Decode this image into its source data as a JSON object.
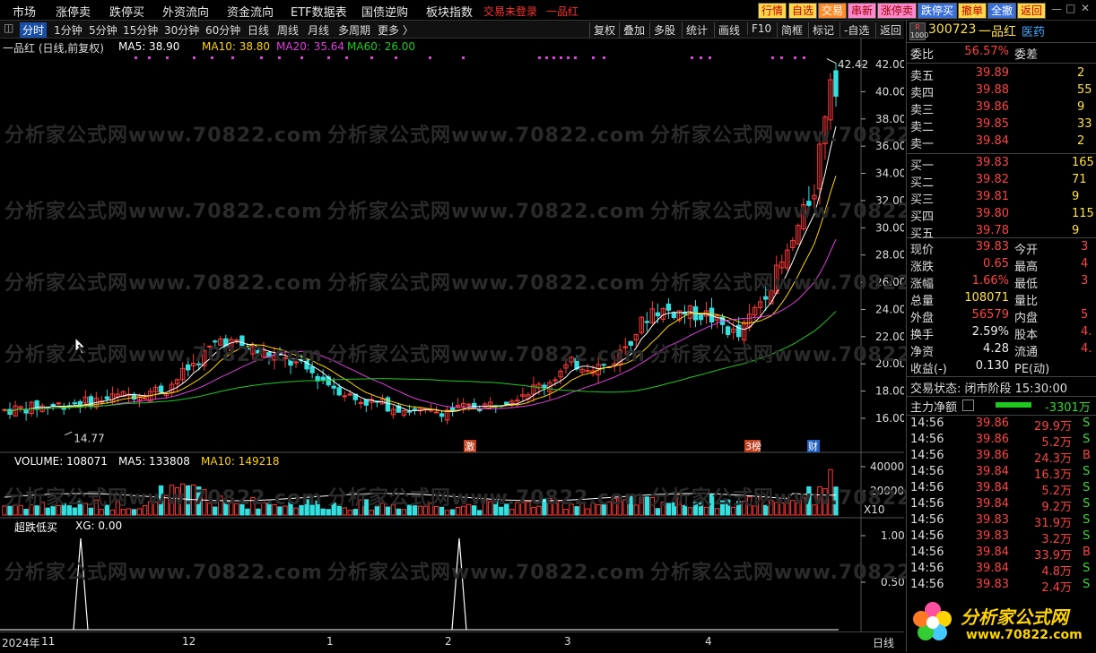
{
  "menu": [
    "市场",
    "涨停卖",
    "跌停买",
    "外资流向",
    "资金流向",
    "ETF数据表",
    "国债逆购",
    "板块指数"
  ],
  "menu_warning": "交易未登录",
  "menu_stock": "一品红",
  "top_buttons": [
    "行情",
    "自选",
    "交易",
    "串新",
    "涨停卖",
    "跌停买",
    "撤单",
    "全撤",
    "返回"
  ],
  "periods": [
    "分时",
    "1分钟",
    "5分钟",
    "15分钟",
    "30分钟",
    "60分钟",
    "日线",
    "周线",
    "月线",
    "多周期",
    "更多 〉"
  ],
  "selected_period": "分时",
  "right_tools": [
    "复权",
    "叠加",
    "多股",
    "统计",
    "画线",
    "F10",
    "简框",
    "标记",
    "-自选",
    "返回"
  ],
  "legend": {
    "title": "一品红 (日线,前复权)",
    "ma5": "MA5: 38.90",
    "ma10": "MA10: 38.80",
    "ma20": "MA20: 35.64",
    "ma60": "MA60: 26.00"
  },
  "price_axis": [
    "42.00",
    "40.00",
    "38.00",
    "36.00",
    "34.00",
    "32.00",
    "30.00",
    "28.00",
    "26.00",
    "24.00",
    "22.00",
    "20.00",
    "18.00",
    "16.00"
  ],
  "price_high_label": "42.42",
  "price_low_label": "14.77",
  "event_tags": [
    "激",
    "3榜",
    "财"
  ],
  "volume_legend": {
    "label": "VOLUME: 108071",
    "ma5": "MA5: 133808",
    "ma10": "MA10: 149218"
  },
  "volume_axis": [
    "40000",
    "20000"
  ],
  "volume_unit": "X10",
  "indicator_legend": {
    "name": "超跌低买",
    "xg": "XG: 0.00"
  },
  "indicator_axis": [
    "1.00",
    "0.50"
  ],
  "date_axis": [
    "2024年",
    "11",
    "12",
    "1",
    "2",
    "3",
    "4"
  ],
  "bottom_right": "日线",
  "watermark": "分析家公式网www.70822.com",
  "quote": {
    "code": "300723",
    "name": "一品红",
    "sector": "医药",
    "weibi_label": "委比",
    "weibi": "56.57%",
    "weicha_label": "委差",
    "asks": [
      {
        "label": "卖五",
        "price": "39.89",
        "vol": "2"
      },
      {
        "label": "卖四",
        "price": "39.88",
        "vol": "55"
      },
      {
        "label": "卖三",
        "price": "39.86",
        "vol": "9"
      },
      {
        "label": "卖二",
        "price": "39.85",
        "vol": "33"
      },
      {
        "label": "卖一",
        "price": "39.84",
        "vol": "2"
      }
    ],
    "bids": [
      {
        "label": "买一",
        "price": "39.83",
        "vol": "165"
      },
      {
        "label": "买二",
        "price": "39.82",
        "vol": "71"
      },
      {
        "label": "买三",
        "price": "39.81",
        "vol": "9"
      },
      {
        "label": "买四",
        "price": "39.80",
        "vol": "115"
      },
      {
        "label": "买五",
        "price": "39.78",
        "vol": "9"
      }
    ],
    "stats": [
      {
        "l1": "现价",
        "v1": "39.83",
        "c1": "red",
        "l2": "今开",
        "v2": "3"
      },
      {
        "l1": "涨跌",
        "v1": "0.65",
        "c1": "red",
        "l2": "最高",
        "v2": "4"
      },
      {
        "l1": "涨幅",
        "v1": "1.66%",
        "c1": "red",
        "l2": "最低",
        "v2": "3"
      },
      {
        "l1": "总量",
        "v1": "108071",
        "c1": "yel",
        "l2": "量比",
        "v2": ""
      },
      {
        "l1": "外盘",
        "v1": "56579",
        "c1": "red",
        "l2": "内盘",
        "v2": "5"
      },
      {
        "l1": "换手",
        "v1": "2.59%",
        "c1": "white",
        "l2": "股本",
        "v2": "4."
      },
      {
        "l1": "净资",
        "v1": "4.28",
        "c1": "white",
        "l2": "流通",
        "v2": "4."
      },
      {
        "l1": "收益(-)",
        "v1": "0.130",
        "c1": "white",
        "l2": "PE(动)",
        "v2": ""
      }
    ],
    "status": "交易状态: 闭市阶段 15:30:00",
    "flow_label": "主力净额",
    "flow_value": "-3301万",
    "ticks": [
      {
        "t": "14:56",
        "p": "39.86",
        "v": "29.9万",
        "s": "S"
      },
      {
        "t": "14:56",
        "p": "39.86",
        "v": "5.2万",
        "s": "S"
      },
      {
        "t": "14:56",
        "p": "39.86",
        "v": "24.3万",
        "s": "B"
      },
      {
        "t": "14:56",
        "p": "39.84",
        "v": "16.3万",
        "s": "S"
      },
      {
        "t": "14:56",
        "p": "39.84",
        "v": "5.2万",
        "s": "S"
      },
      {
        "t": "14:56",
        "p": "39.84",
        "v": "9.2万",
        "s": "S"
      },
      {
        "t": "14:56",
        "p": "39.83",
        "v": "31.9万",
        "s": "S"
      },
      {
        "t": "14:56",
        "p": "39.83",
        "v": "3.2万",
        "s": "S"
      },
      {
        "t": "14:56",
        "p": "39.84",
        "v": "33.9万",
        "s": "B"
      },
      {
        "t": "14:56",
        "p": "39.84",
        "v": "4.8万",
        "s": "S"
      },
      {
        "t": "14:56",
        "p": "39.83",
        "v": "2.4万",
        "s": "S"
      }
    ]
  },
  "colors": {
    "up": "#ff3b3b",
    "down": "#33e0e0",
    "ma5": "#ffffff",
    "ma10": "#ffd400",
    "ma20": "#e040e0",
    "ma60": "#22cc22"
  }
}
